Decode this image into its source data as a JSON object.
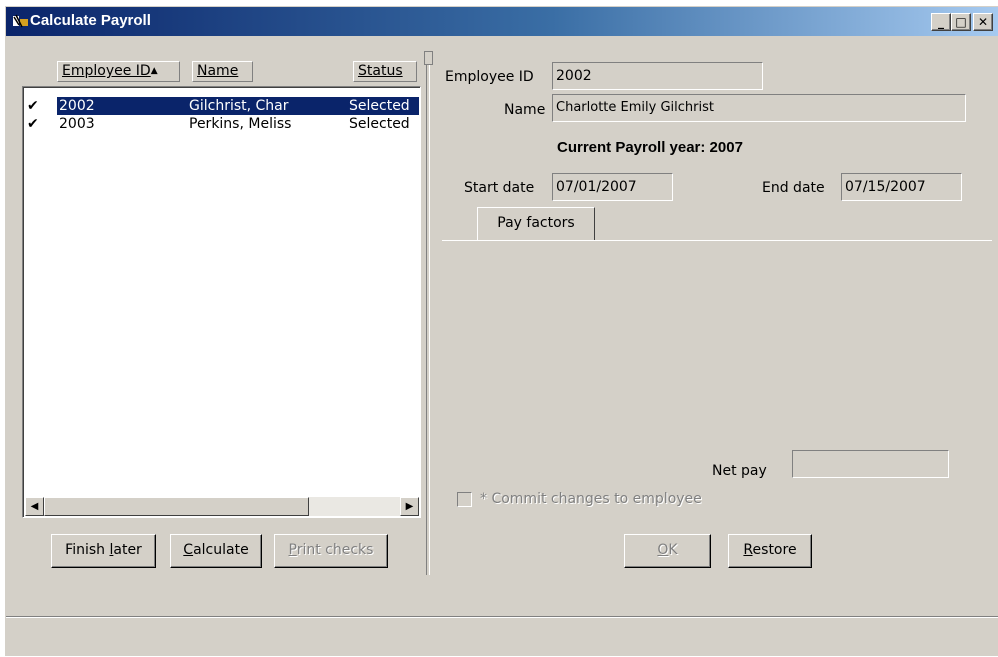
{
  "window": {
    "title": "Calculate Payroll",
    "controls": {
      "minimize": "_",
      "maximize": "□",
      "close": "✕"
    }
  },
  "list": {
    "columns": {
      "employee_id": "Employee ID",
      "sort_indicator": "▲",
      "name": "Name",
      "status": "Status"
    },
    "rows": [
      {
        "check": "✔",
        "id": "2002",
        "name": "Gilchrist, Char",
        "status": "Selected",
        "selected": true
      },
      {
        "check": "✔",
        "id": "2003",
        "name": "Perkins, Meliss",
        "status": "Selected",
        "selected": false
      }
    ],
    "scroll_left": "◀",
    "scroll_right": "▶"
  },
  "buttons": {
    "finish_later": {
      "pre": "Finish ",
      "u": "l",
      "post": "ater"
    },
    "calculate": {
      "pre": "",
      "u": "C",
      "post": "alculate"
    },
    "print_checks": {
      "pre": "",
      "u": "P",
      "post": "rint checks"
    },
    "ok": {
      "pre": "",
      "u": "O",
      "post": "K"
    },
    "restore": {
      "pre": "",
      "u": "R",
      "post": "estore"
    }
  },
  "detail": {
    "employee_id_label": "Employee ID",
    "employee_id_value": "2002",
    "name_label": "Name",
    "name_value": "Charlotte Emily Gilchrist",
    "payroll_year_heading": "Current Payroll year: 2007",
    "start_date_label": "Start date",
    "start_date_value": "07/01/2007",
    "end_date_label": "End date",
    "end_date_value": "07/15/2007",
    "tab_label": "Pay factors",
    "net_pay_label": "Net pay",
    "net_pay_value": "",
    "commit_label": "* Commit changes to employee"
  },
  "colors": {
    "face": "#d4d0c8",
    "title_start": "#0a246a",
    "title_end": "#a6caf0",
    "selection": "#0a246a"
  },
  "icons": {
    "app": "payroll-app-icon",
    "check": "check-mark-icon"
  }
}
